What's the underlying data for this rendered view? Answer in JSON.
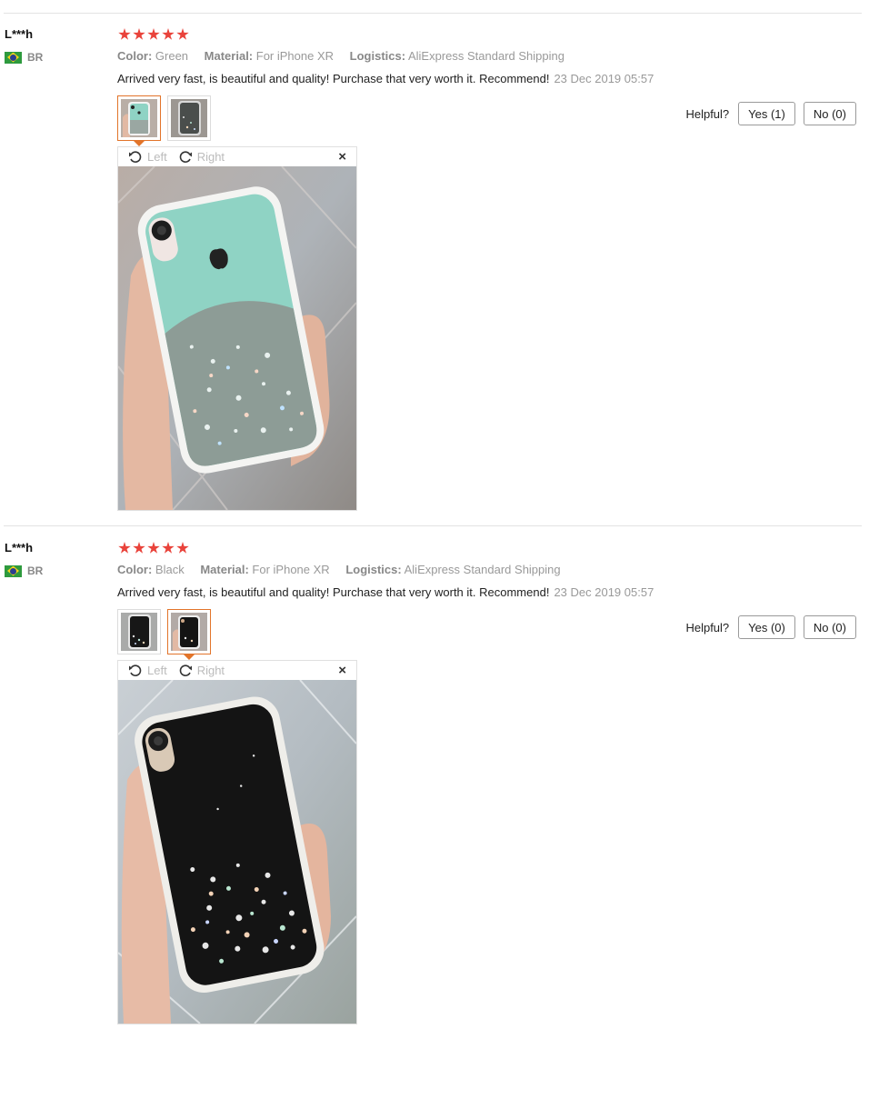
{
  "reviews": [
    {
      "user": "L***h",
      "country": "BR",
      "rating": 5,
      "attrs": [
        {
          "key": "Color:",
          "value": "Green"
        },
        {
          "key": "Material:",
          "value": "For iPhone XR"
        },
        {
          "key": "Logistics:",
          "value": "AliExpress Standard Shipping"
        }
      ],
      "text": "Arrived very fast, is beautiful and quality! Purchase that very worth it. Recommend!",
      "date": "23 Dec 2019 05:57",
      "helpful_label": "Helpful?",
      "yes_label": "Yes (1)",
      "no_label": "No (0)",
      "viewer": {
        "left_label": "Left",
        "right_label": "Right",
        "close_label": "×"
      },
      "case_color": "#8fd3c4",
      "active_thumb": 1
    },
    {
      "user": "L***h",
      "country": "BR",
      "rating": 5,
      "attrs": [
        {
          "key": "Color:",
          "value": "Black"
        },
        {
          "key": "Material:",
          "value": "For iPhone XR"
        },
        {
          "key": "Logistics:",
          "value": "AliExpress Standard Shipping"
        }
      ],
      "text": "Arrived very fast, is beautiful and quality! Purchase that very worth it. Recommend!",
      "date": "23 Dec 2019 05:57",
      "helpful_label": "Helpful?",
      "yes_label": "Yes (0)",
      "no_label": "No (0)",
      "viewer": {
        "left_label": "Left",
        "right_label": "Right",
        "close_label": "×"
      },
      "case_color": "#141414",
      "active_thumb": 2
    }
  ],
  "colors": {
    "star": "#e9433b",
    "active_border": "#e2742a",
    "muted": "#999999"
  }
}
